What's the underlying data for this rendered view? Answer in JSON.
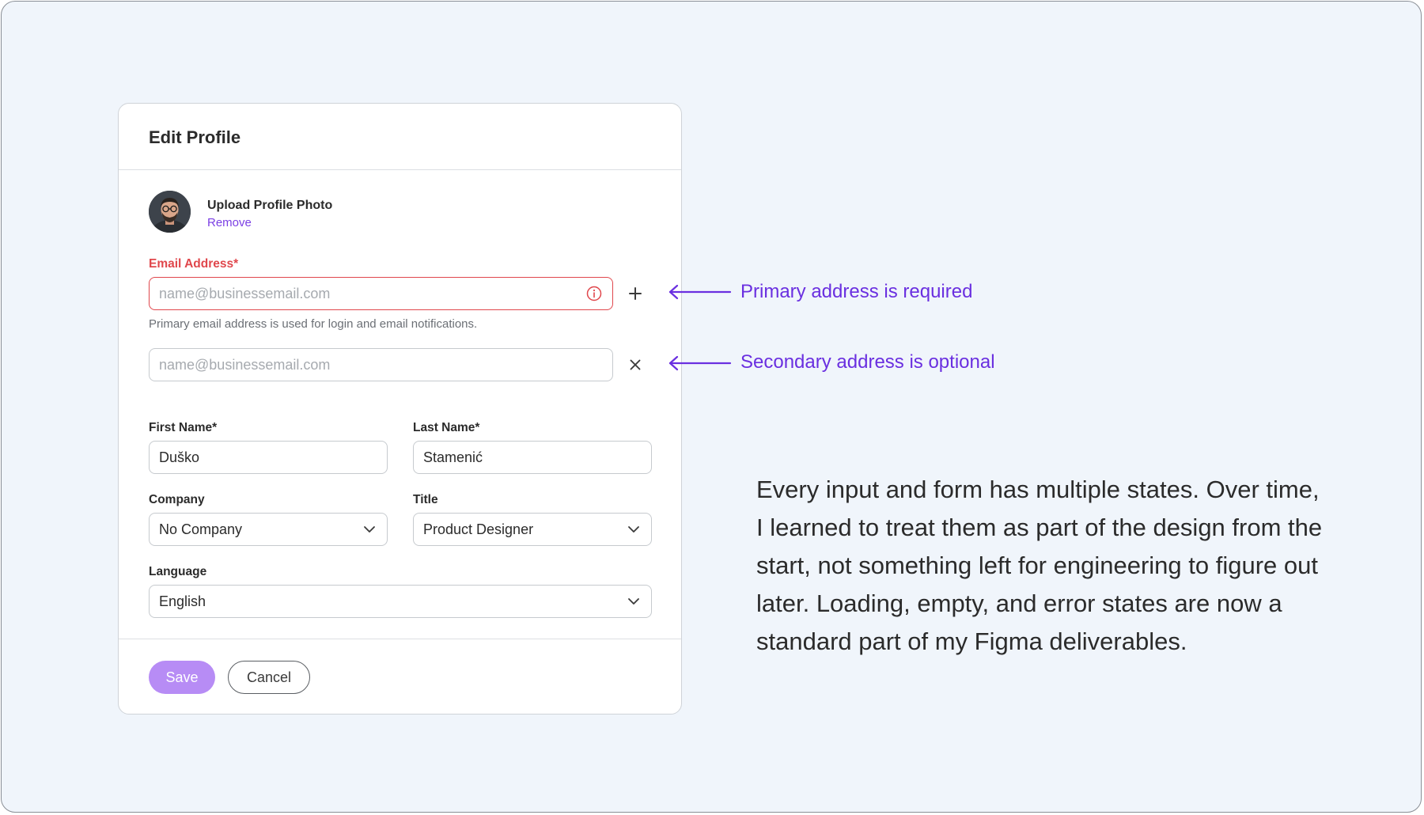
{
  "form": {
    "title": "Edit Profile",
    "photo": {
      "label": "Upload Profile Photo",
      "remove": "Remove"
    },
    "email": {
      "label": "Email Address*",
      "placeholder": "name@businessemail.com",
      "value": "",
      "help": "Primary email address is used for login and email notifications.",
      "state": "error"
    },
    "secondary_email": {
      "placeholder": "name@businessemail.com",
      "value": ""
    },
    "first_name": {
      "label": "First Name*",
      "value": "Duško"
    },
    "last_name": {
      "label": "Last Name*",
      "value": "Stamenić"
    },
    "company": {
      "label": "Company",
      "value": "No Company"
    },
    "title_field": {
      "label": "Title",
      "value": "Product Designer"
    },
    "language": {
      "label": "Language",
      "value": "English"
    },
    "buttons": {
      "save": "Save",
      "cancel": "Cancel"
    }
  },
  "annotations": {
    "primary": "Primary address is required",
    "secondary": "Secondary address is optional"
  },
  "description": "Every input and form has multiple states. Over time, I learned to treat them as part of the design from the start, not something left for engineering to figure out later. Loading, empty, and error states are now a standard part of my Figma deliverables.",
  "colors": {
    "accent": "#6a2fe0",
    "link": "#7b3fe4",
    "error": "#e0474c",
    "save_button": "#b78cf5",
    "background": "#f0f5fb"
  },
  "icons": [
    "info-icon",
    "plus-icon",
    "close-icon",
    "chevron-down-icon",
    "arrow-left-icon"
  ]
}
